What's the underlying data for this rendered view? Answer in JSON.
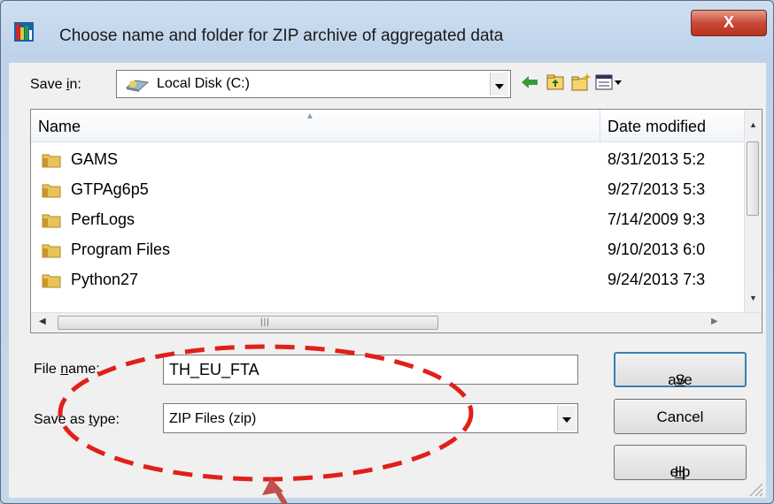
{
  "window": {
    "title": "Choose name and folder for ZIP archive of aggregated data",
    "close_label": "X"
  },
  "save_in": {
    "label_pre": "Save ",
    "label_accel": "i",
    "label_post": "n:",
    "value": "Local Disk (C:)"
  },
  "toolbar": {
    "icons": [
      "back-icon",
      "up-folder-icon",
      "new-folder-icon",
      "view-menu-icon"
    ]
  },
  "list": {
    "columns": [
      "Name",
      "Date modified"
    ],
    "rows": [
      {
        "name": "GAMS",
        "date": "8/31/2013 5:2"
      },
      {
        "name": "GTPAg6p5",
        "date": "9/27/2013 5:3"
      },
      {
        "name": "PerfLogs",
        "date": "7/14/2009 9:3"
      },
      {
        "name": "Program Files",
        "date": "9/10/2013 6:0"
      },
      {
        "name": "Python27",
        "date": "9/24/2013 7:3"
      }
    ]
  },
  "file_name": {
    "label_pre": "File ",
    "label_accel": "n",
    "label_post": "ame:",
    "value": "TH_EU_FTA"
  },
  "save_as_type": {
    "label_pre": "Save as ",
    "label_accel": "t",
    "label_post": "ype:",
    "value": "ZIP Files (zip)"
  },
  "buttons": {
    "save_accel": "S",
    "save_rest": "ave",
    "cancel": "Cancel",
    "help_accel": "H",
    "help_rest": "elp"
  },
  "colors": {
    "annotation": "#e0201a",
    "arrow": "#c0504d",
    "default_button_border": "#3c7fb1"
  }
}
